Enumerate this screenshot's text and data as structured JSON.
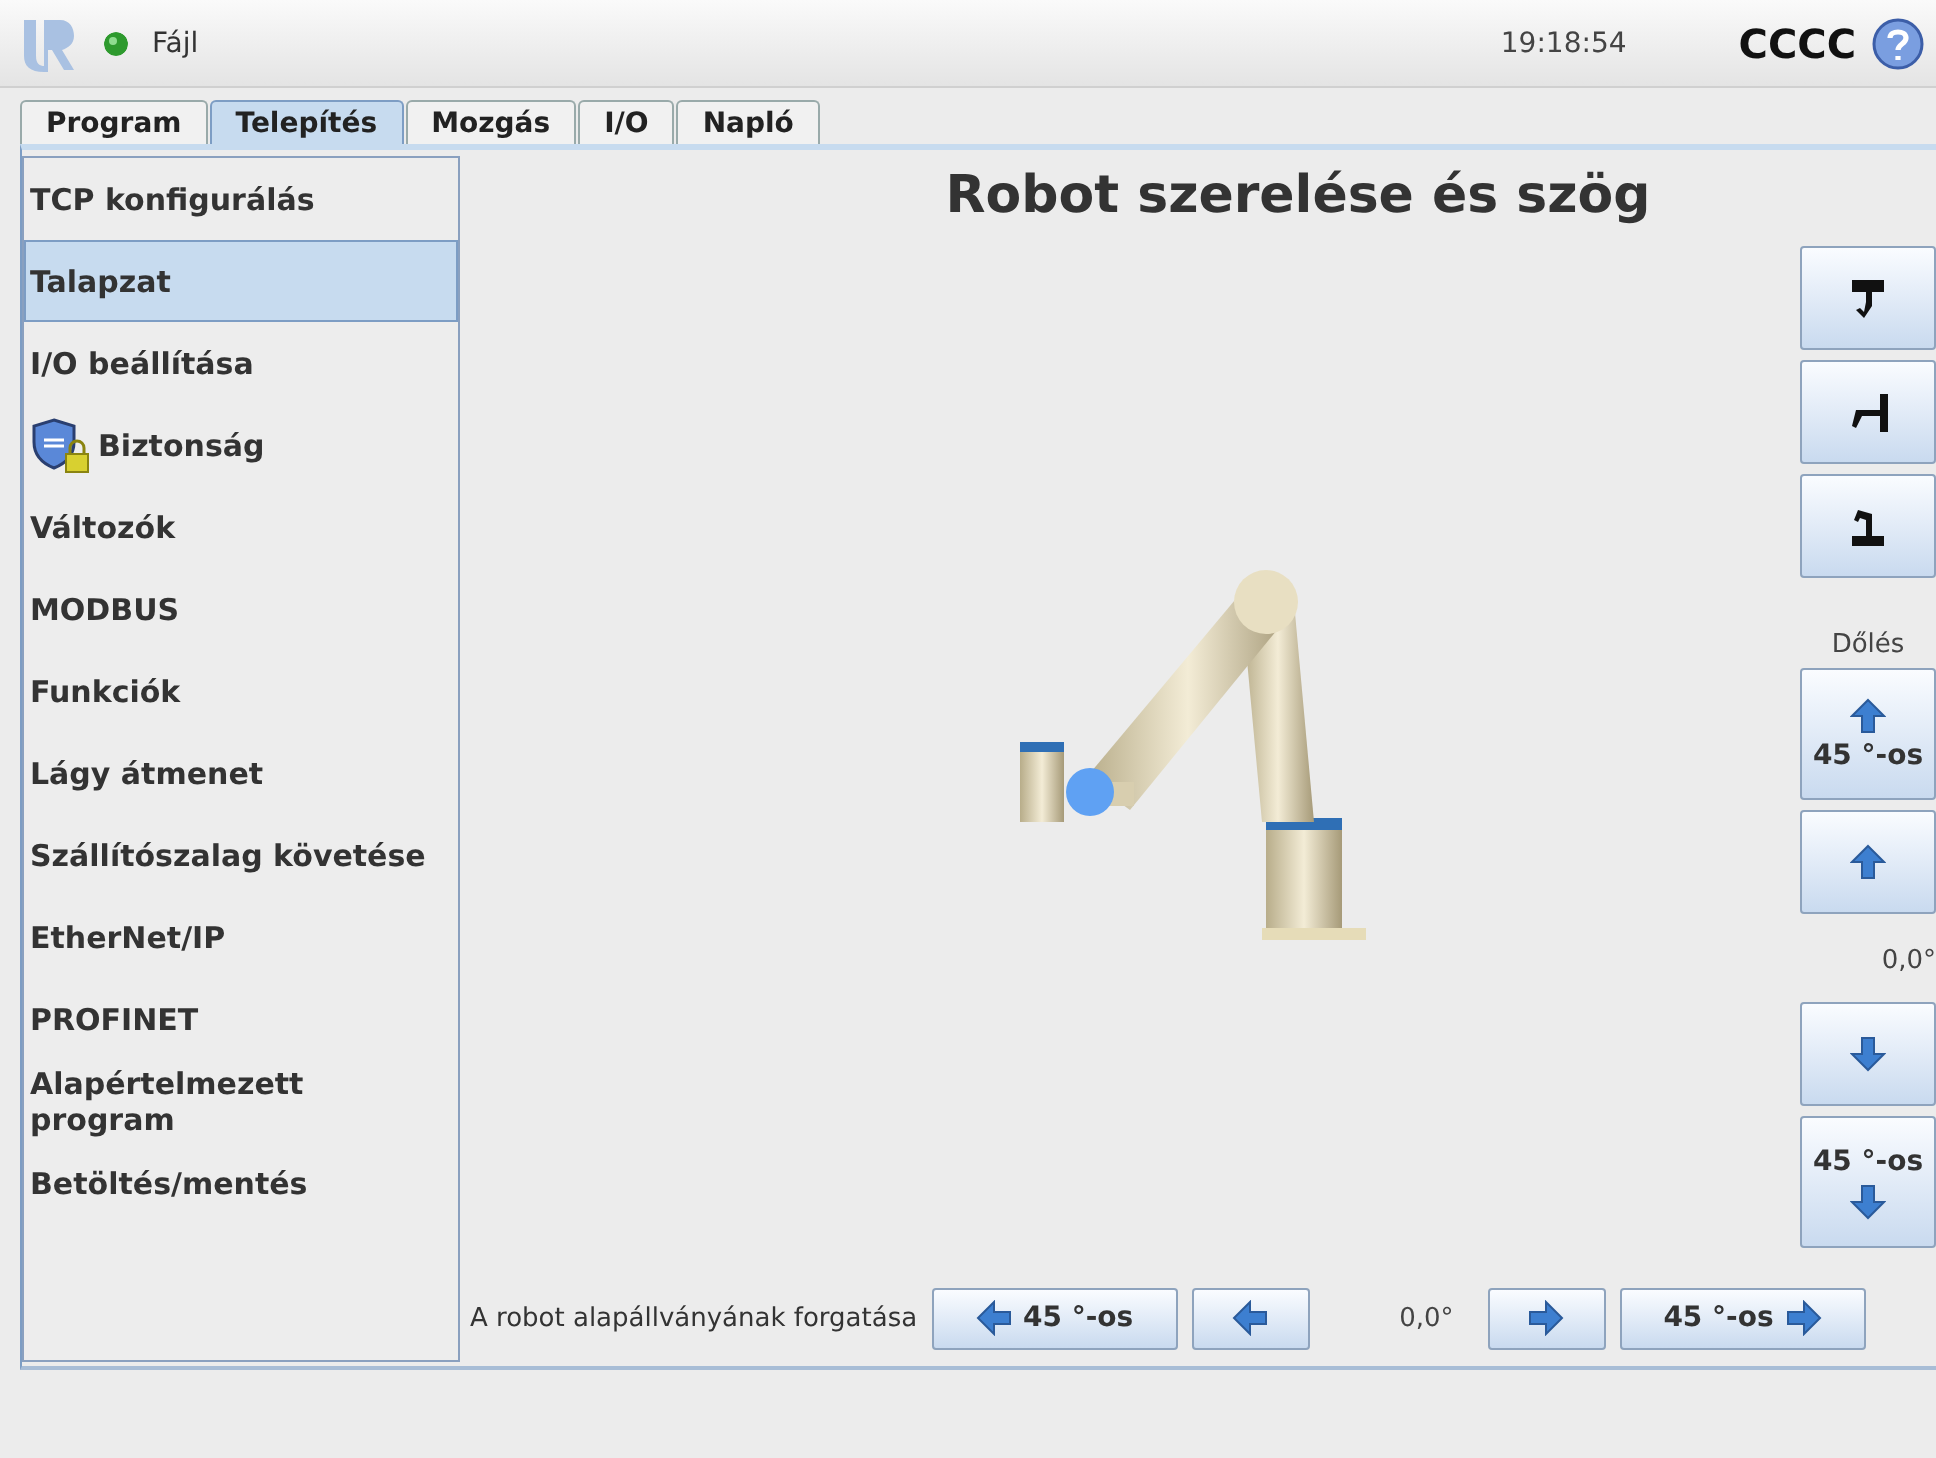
{
  "header": {
    "menu": "Fájl",
    "time": "19:18:54",
    "robot_name": "CCCC"
  },
  "tabs": [
    {
      "label": "Program",
      "selected": false
    },
    {
      "label": "Telepítés",
      "selected": true
    },
    {
      "label": "Mozgás",
      "selected": false
    },
    {
      "label": "I/O",
      "selected": false
    },
    {
      "label": "Napló",
      "selected": false
    }
  ],
  "sidebar": {
    "items": [
      {
        "label": "TCP konfigurálás",
        "selected": false,
        "kind": "plain"
      },
      {
        "label": "Talapzat",
        "selected": true,
        "kind": "plain"
      },
      {
        "label": "I/O beállítása",
        "selected": false,
        "kind": "plain"
      },
      {
        "label": "Biztonság",
        "selected": false,
        "kind": "security"
      },
      {
        "label": "Változók",
        "selected": false,
        "kind": "plain"
      },
      {
        "label": "MODBUS",
        "selected": false,
        "kind": "plain"
      },
      {
        "label": "Funkciók",
        "selected": false,
        "kind": "plain"
      },
      {
        "label": "Lágy átmenet",
        "selected": false,
        "kind": "plain"
      },
      {
        "label": "Szállítószalag követése",
        "selected": false,
        "kind": "plain"
      },
      {
        "label": "EtherNet/IP",
        "selected": false,
        "kind": "plain"
      },
      {
        "label": "PROFINET",
        "selected": false,
        "kind": "plain"
      },
      {
        "label": "Alapértelmezett program",
        "selected": false,
        "kind": "plain"
      },
      {
        "label": "Betöltés/mentés",
        "selected": false,
        "kind": "plain"
      }
    ]
  },
  "title": "Robot szerelése és szög",
  "mount_buttons": [
    {
      "kind": "ceiling"
    },
    {
      "kind": "wall"
    },
    {
      "kind": "floor"
    }
  ],
  "tilt": {
    "label": "Dőlés",
    "items": [
      {
        "kind": "up",
        "label": "45 °-os"
      },
      {
        "kind": "up"
      },
      {
        "kind": "reading",
        "label": "0,0°"
      },
      {
        "kind": "down"
      },
      {
        "kind": "down",
        "label": "45 °-os"
      }
    ]
  },
  "rotation": {
    "label": "A robot alapállványának forgatása",
    "items": [
      {
        "kind": "left",
        "label": "45 °-os"
      },
      {
        "kind": "left"
      },
      {
        "kind": "reading",
        "label": "0,0°"
      },
      {
        "kind": "right"
      },
      {
        "kind": "right",
        "label": "45 °-os"
      }
    ]
  }
}
